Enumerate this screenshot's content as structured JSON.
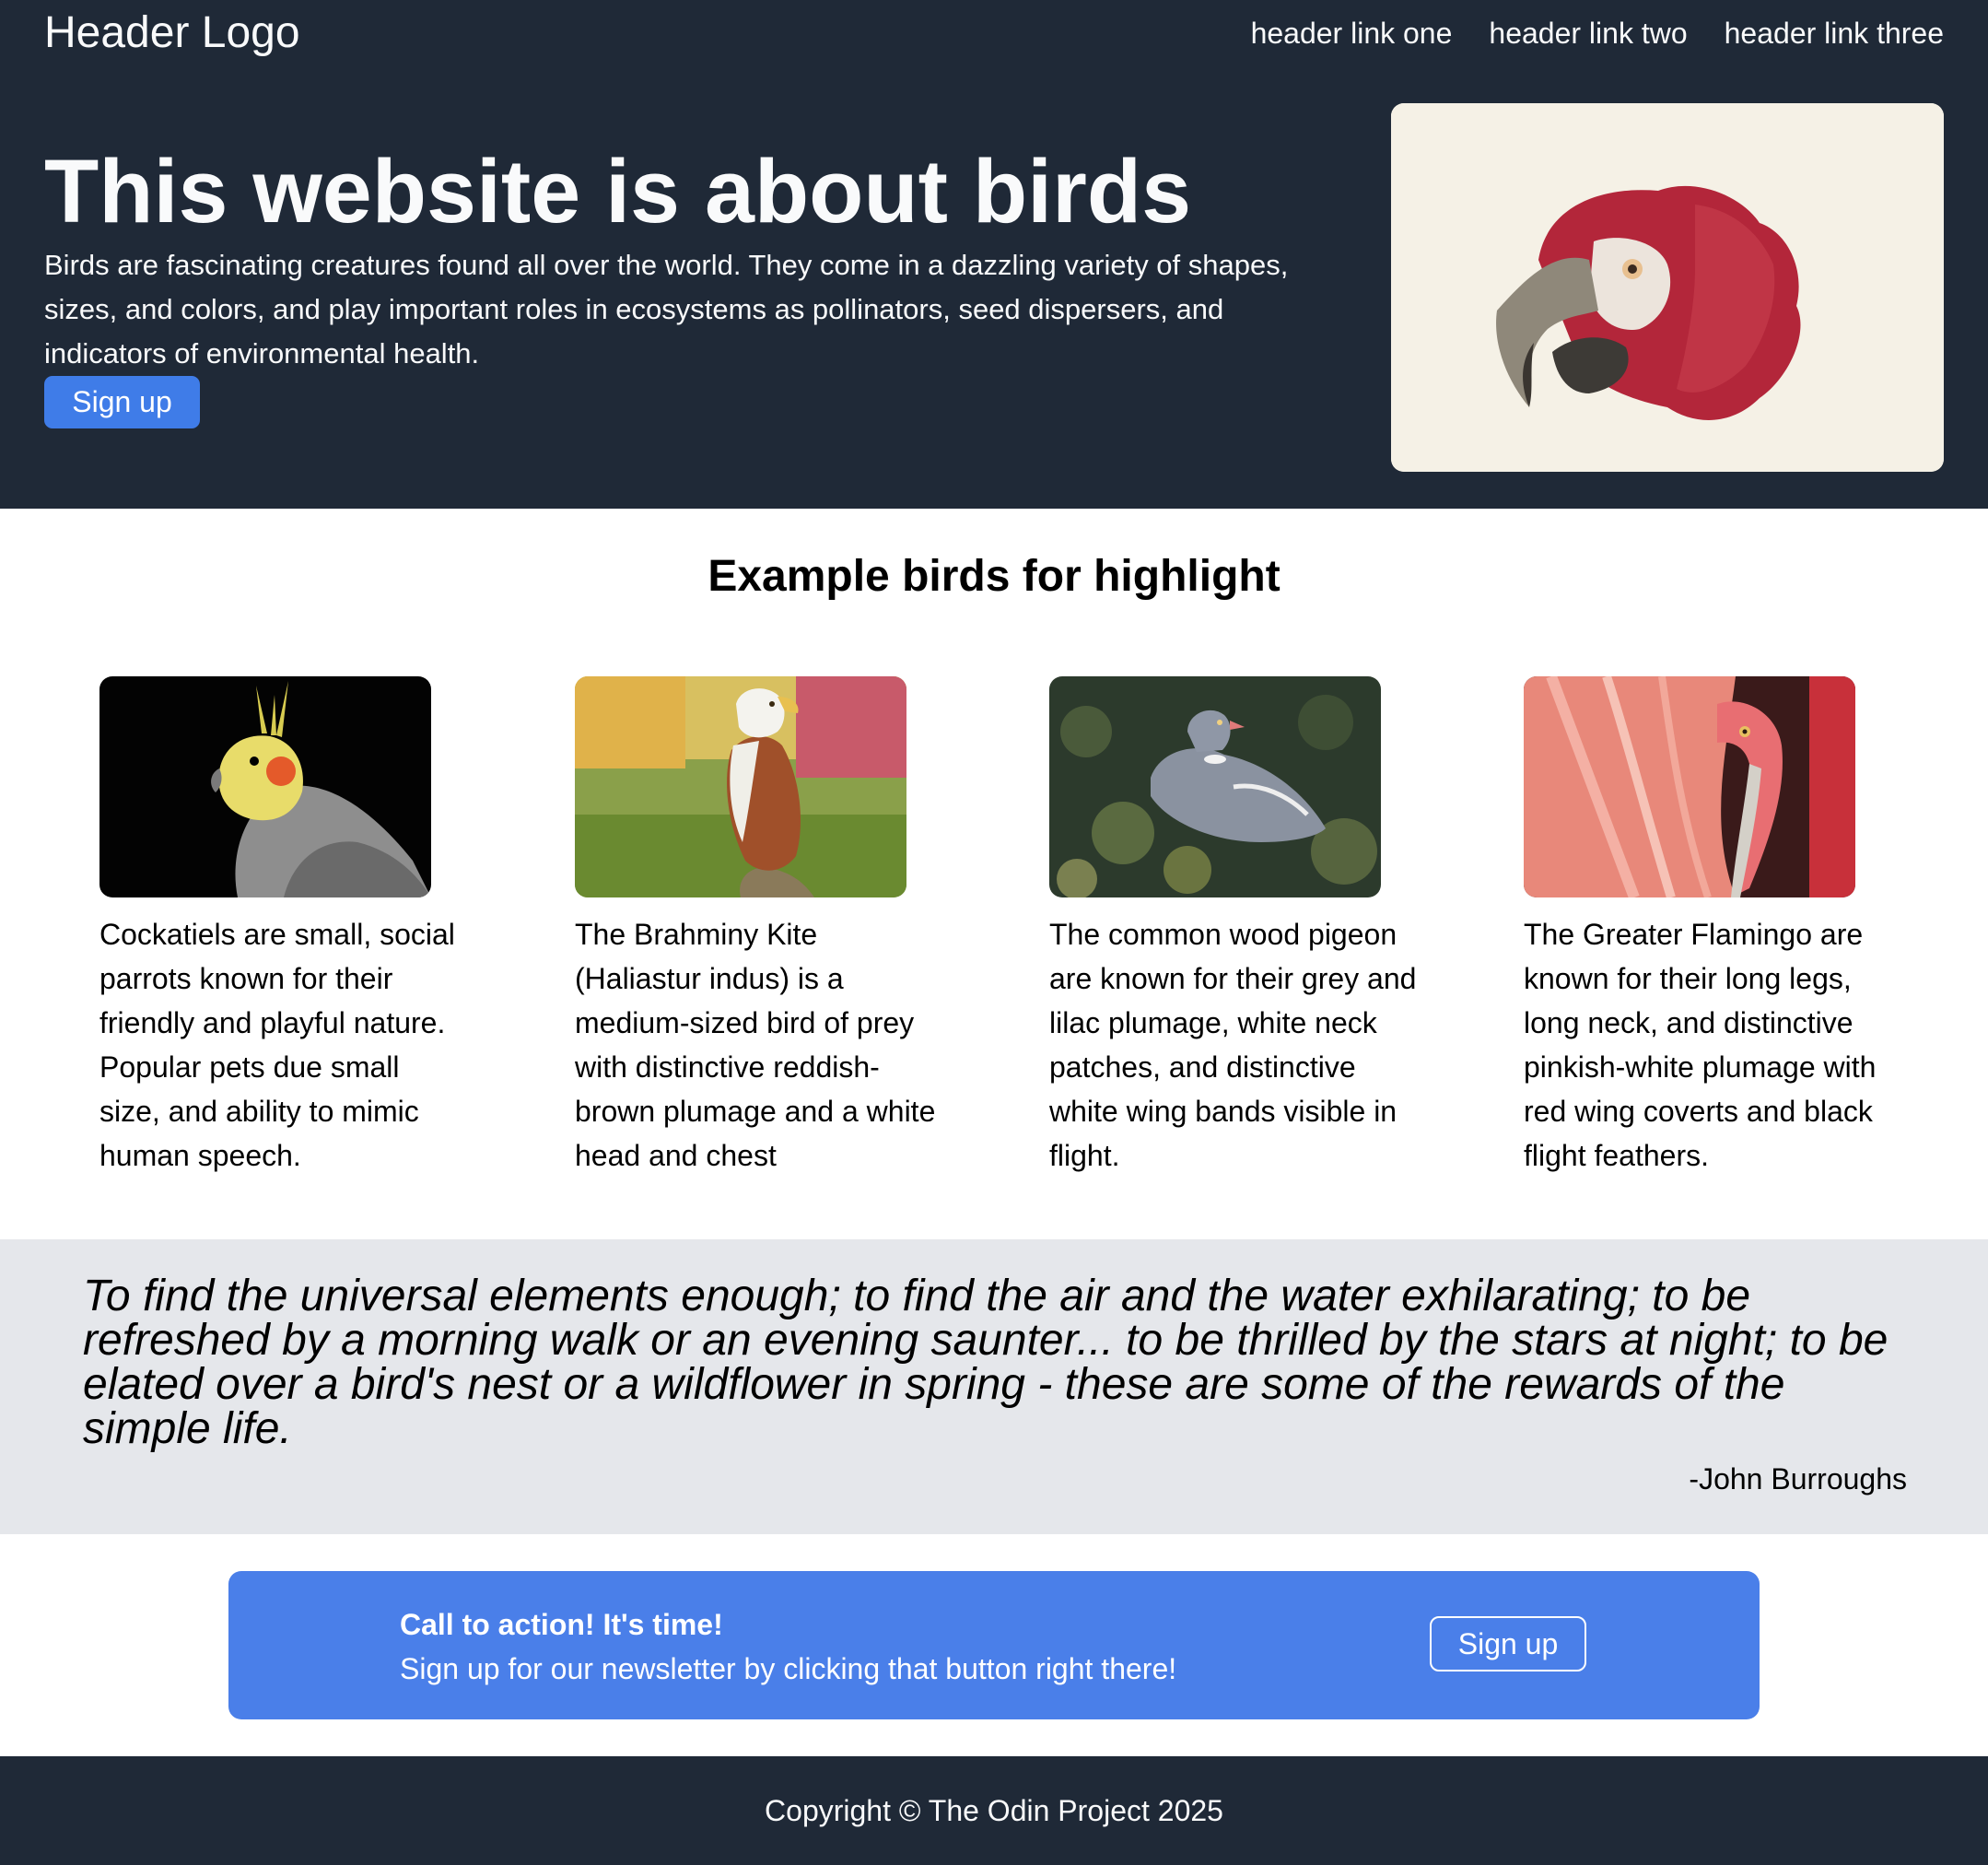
{
  "header": {
    "logo": "Header Logo",
    "links": [
      "header link one",
      "header link two",
      "header link three"
    ]
  },
  "hero": {
    "title": "This website is about birds",
    "text": "Birds are fascinating creatures found all over the world. They come in a dazzling variety of shapes, sizes, and colors, and play important roles in ecosystems as pollinators, seed dispersers, and indicators of environmental health.",
    "button": "Sign up",
    "image_subject": "macaw-parrot-illustration"
  },
  "highlights": {
    "title": "Example birds for highlight",
    "cards": [
      {
        "image_subject": "cockatiel-photo",
        "text": "Cockatiels are small, social parrots known for their friendly and playful nature. Popular pets due small size, and ability to mimic human speech."
      },
      {
        "image_subject": "brahminy-kite-photo",
        "text": "The Brahminy Kite (Haliastur indus) is a medium-sized bird of prey with distinctive reddish-brown plumage and a white head and chest"
      },
      {
        "image_subject": "wood-pigeon-photo",
        "text": "The common wood pigeon are known for their grey and lilac plumage, white neck patches, and distinctive white wing bands visible in flight."
      },
      {
        "image_subject": "greater-flamingo-photo",
        "text": "The Greater Flamingo are known for their long legs, long neck, and distinctive pinkish-white plumage with red wing coverts and black flight feathers."
      }
    ]
  },
  "quote": {
    "text": "To find the universal elements enough; to find the air and the water exhilarating; to be refreshed by a morning walk or an evening saunter... to be thrilled by the stars at night; to be elated over a bird's nest or a wildflower in spring - these are some of the rewards of the simple life.",
    "author": "-John Burroughs"
  },
  "cta": {
    "title": "Call to action! It's time!",
    "text": "Sign up for our newsletter by clicking that button right there!",
    "button": "Sign up"
  },
  "footer": {
    "text": "Copyright © The Odin Project 2025"
  },
  "colors": {
    "dark_background": "#1f2937",
    "accent_blue": "#3f7ce8",
    "cta_blue": "#4a7fe9",
    "quote_background": "#e5e7eb"
  }
}
